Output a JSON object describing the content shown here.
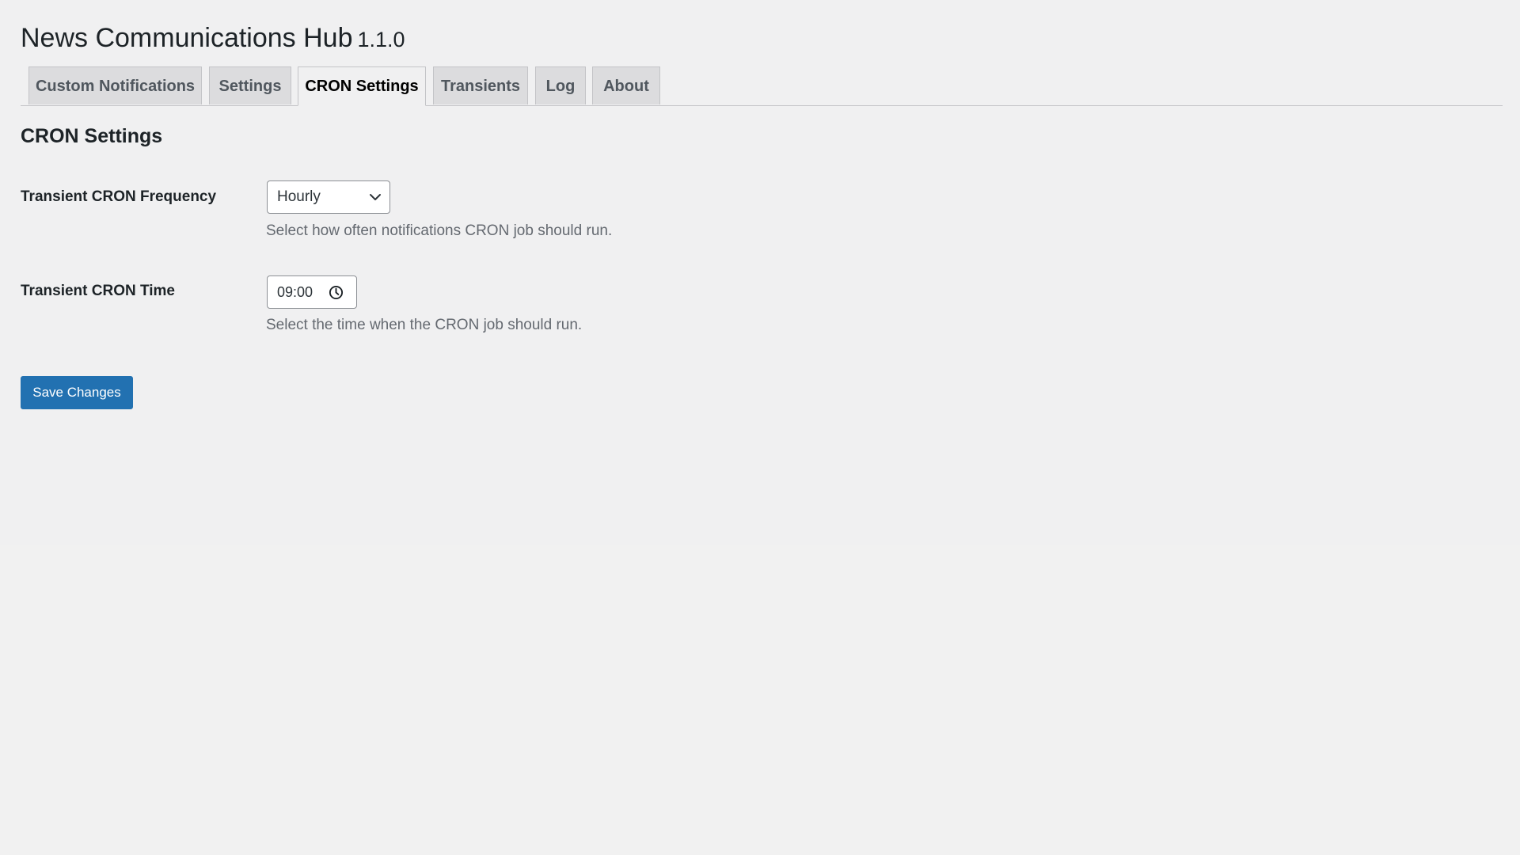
{
  "header": {
    "title": "News Communications Hub",
    "version": "1.1.0"
  },
  "tabs": [
    {
      "label": "Custom Notifications",
      "active": false
    },
    {
      "label": "Settings",
      "active": false
    },
    {
      "label": "CRON Settings",
      "active": true
    },
    {
      "label": "Transients",
      "active": false
    },
    {
      "label": "Log",
      "active": false
    },
    {
      "label": "About",
      "active": false
    }
  ],
  "section": {
    "title": "CRON Settings"
  },
  "fields": {
    "frequency": {
      "label": "Transient CRON Frequency",
      "value": "Hourly",
      "description": "Select how often notifications CRON job should run.",
      "icon": "chevron-down-icon"
    },
    "time": {
      "label": "Transient CRON Time",
      "value": "09:00",
      "description": "Select the time when the CRON job should run.",
      "icon": "clock-icon"
    }
  },
  "actions": {
    "save_label": "Save Changes"
  },
  "colors": {
    "page_background": "#f0f0f1",
    "primary_button": "#2271b1",
    "tab_inactive": "#dcdcde",
    "description_text": "#646970"
  }
}
